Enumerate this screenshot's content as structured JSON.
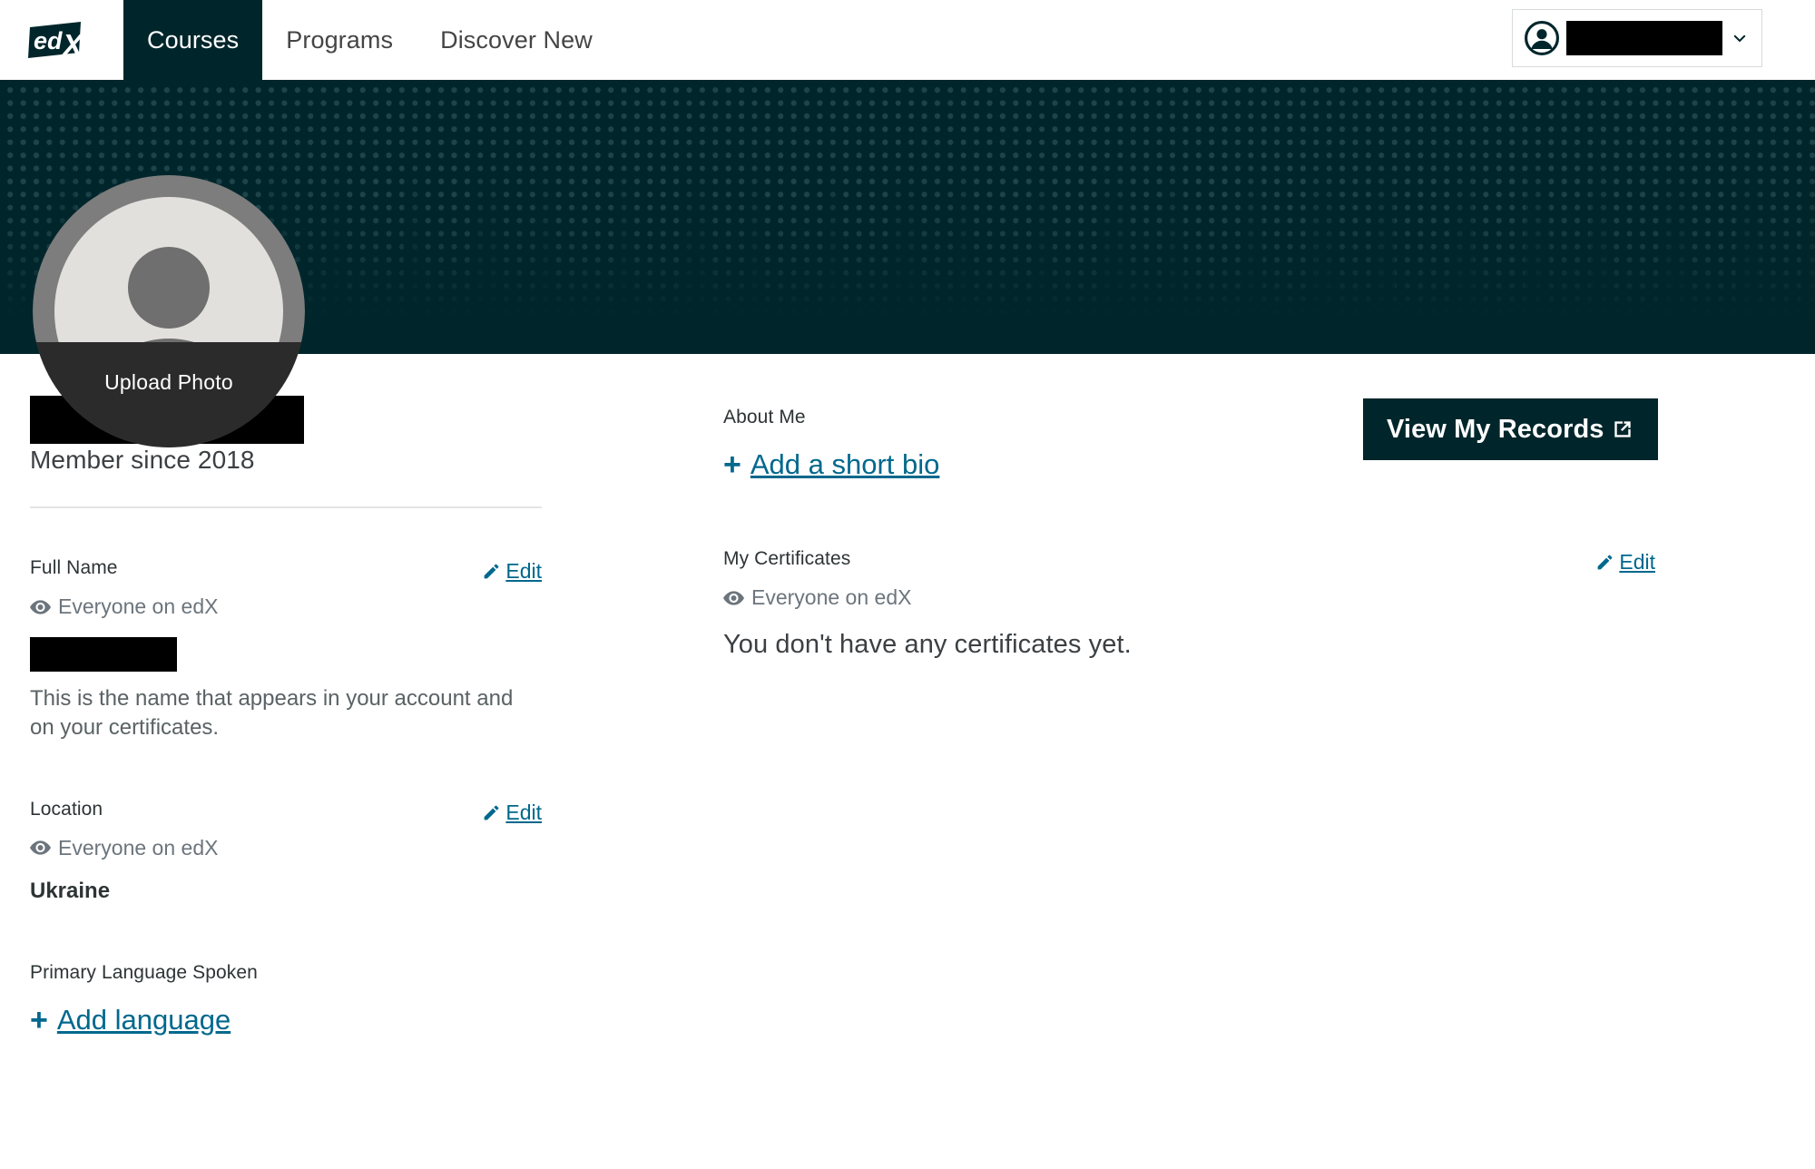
{
  "nav": {
    "logo_alt": "edX",
    "items": [
      {
        "label": "Courses",
        "active": true
      },
      {
        "label": "Programs",
        "active": false
      },
      {
        "label": "Discover New",
        "active": false
      }
    ],
    "user_menu": {
      "name_redacted": "",
      "avatar_icon": "user-circle-icon",
      "chevron_icon": "chevron-down-icon"
    }
  },
  "hero": {
    "background_color": "#00262B",
    "dot_color": "#1D444A"
  },
  "avatar": {
    "upload_label": "Upload Photo",
    "icon": "default-user-avatar-icon"
  },
  "actions": {
    "view_records_label": "View My Records",
    "view_records_icon": "external-link-icon"
  },
  "profile": {
    "display_name_redacted": "",
    "member_since": "Member since 2018"
  },
  "fields": [
    {
      "label": "Full Name",
      "edit_label": "Edit",
      "visibility": "Everyone on edX",
      "value_redacted": "",
      "help": "This is the name that appears in your account and on your certificates."
    },
    {
      "label": "Location",
      "edit_label": "Edit",
      "visibility": "Everyone on edX",
      "value": "Ukraine"
    },
    {
      "label": "Primary Language Spoken",
      "add_label": "Add language",
      "add_plus": "+"
    }
  ],
  "about_me": {
    "label": "About Me",
    "add_label": "Add a short bio",
    "add_plus": "+"
  },
  "certificates": {
    "label": "My Certificates",
    "edit_label": "Edit",
    "visibility": "Everyone on edX",
    "empty_message": "You don't have any certificates yet."
  },
  "colors": {
    "brand_dark": "#00262B",
    "link": "#00688D",
    "muted": "#6C757D"
  }
}
